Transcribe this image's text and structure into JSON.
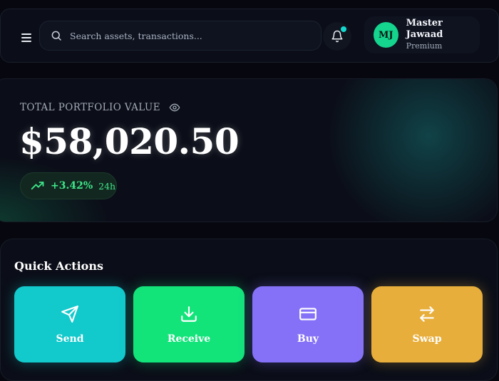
{
  "header": {
    "search": {
      "placeholder": "Search assets, transactions..."
    },
    "notification": {
      "has_unread": true,
      "dot_color": "#14d8cf"
    },
    "profile": {
      "initials": "MJ",
      "name": "Master Jawaad",
      "tier": "Premium",
      "avatar_color": "#14d48e"
    }
  },
  "portfolio": {
    "label": "TOTAL PORTFOLIO VALUE",
    "value": "$58,020.50",
    "change": {
      "percent": "+3.42%",
      "period": "24h",
      "color": "#3ee58a"
    }
  },
  "quick_actions": {
    "title": "Quick Actions",
    "items": [
      {
        "label": "Send",
        "icon": "send-icon",
        "color": "#12c9cc"
      },
      {
        "label": "Receive",
        "icon": "download-icon",
        "color": "#12e47a"
      },
      {
        "label": "Buy",
        "icon": "credit-card-icon",
        "color": "#8571f7"
      },
      {
        "label": "Swap",
        "icon": "swap-arrows-icon",
        "color": "#e8ae3b"
      }
    ]
  }
}
